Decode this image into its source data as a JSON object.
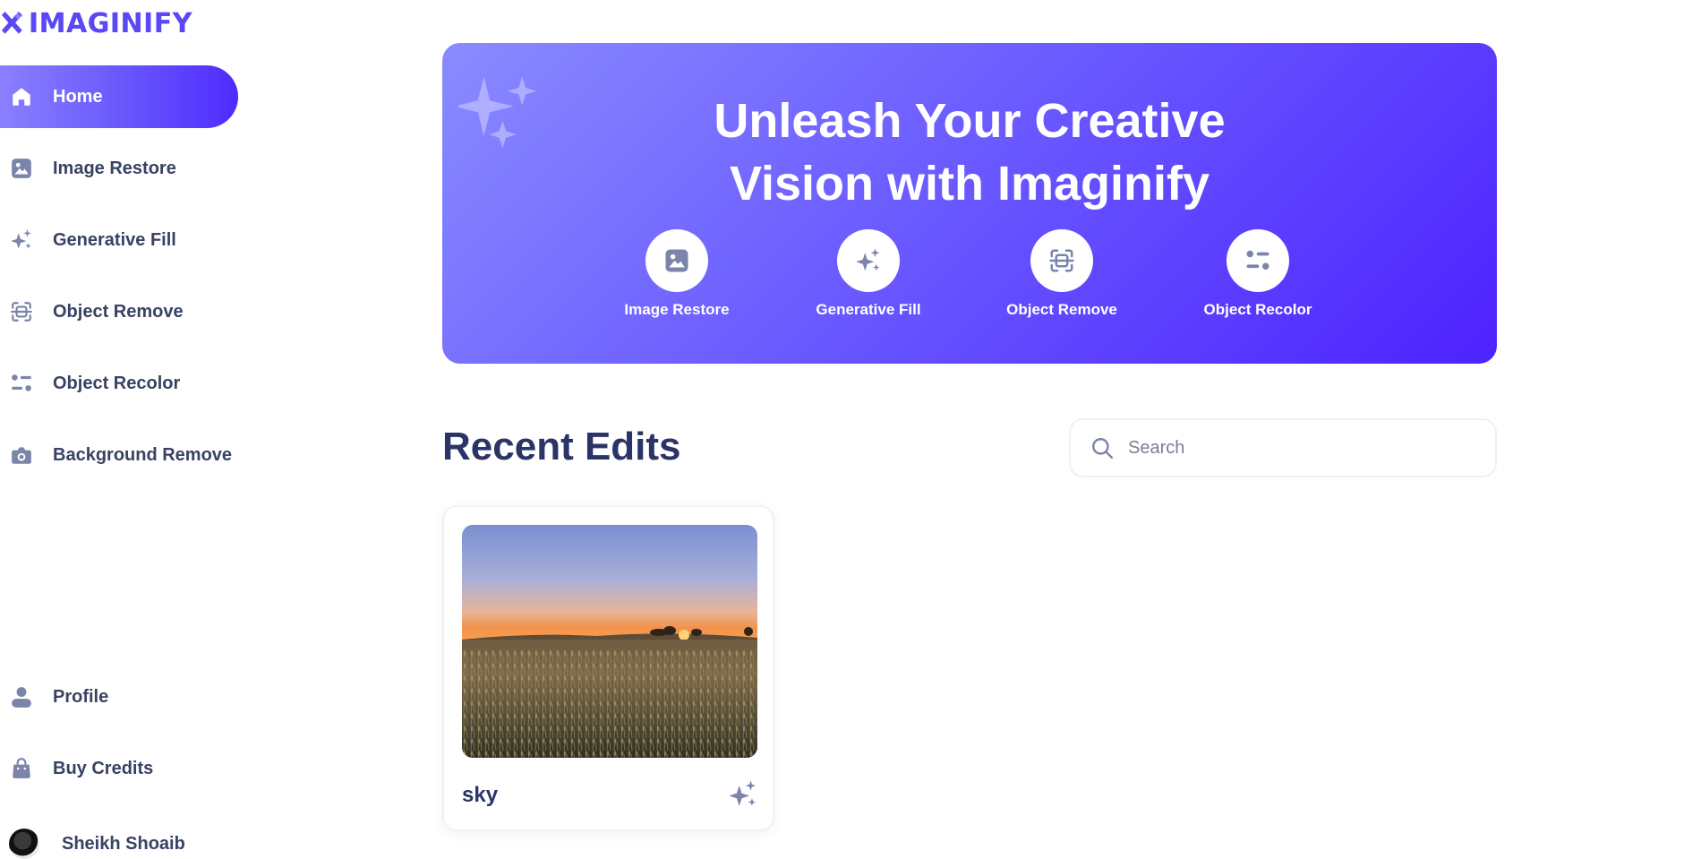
{
  "brand": {
    "name": "IMAGINIFY"
  },
  "sidebar": {
    "items": [
      {
        "label": "Home",
        "icon": "home-icon",
        "active": true
      },
      {
        "label": "Image Restore",
        "icon": "image-icon"
      },
      {
        "label": "Generative Fill",
        "icon": "stars-icon"
      },
      {
        "label": "Object Remove",
        "icon": "scan-icon"
      },
      {
        "label": "Object Recolor",
        "icon": "filter-icon"
      },
      {
        "label": "Background Remove",
        "icon": "camera-icon"
      }
    ],
    "bottom_items": [
      {
        "label": "Profile",
        "icon": "profile-icon"
      },
      {
        "label": "Buy Credits",
        "icon": "bag-icon"
      }
    ],
    "user": {
      "name": "Sheikh Shoaib"
    }
  },
  "hero": {
    "title_line1": "Unleash Your Creative",
    "title_line2": "Vision with Imaginify",
    "tools": [
      {
        "label": "Image Restore",
        "icon": "image-icon"
      },
      {
        "label": "Generative Fill",
        "icon": "stars-icon"
      },
      {
        "label": "Object Remove",
        "icon": "scan-icon"
      },
      {
        "label": "Object Recolor",
        "icon": "filter-icon"
      }
    ]
  },
  "recent": {
    "title": "Recent Edits",
    "search_placeholder": "Search",
    "cards": [
      {
        "title": "sky",
        "icon": "stars-icon"
      }
    ]
  },
  "colors": {
    "accent": "#5b48f5",
    "text": "#384262",
    "heading": "#2a3467",
    "icon": "#7b84a9"
  }
}
